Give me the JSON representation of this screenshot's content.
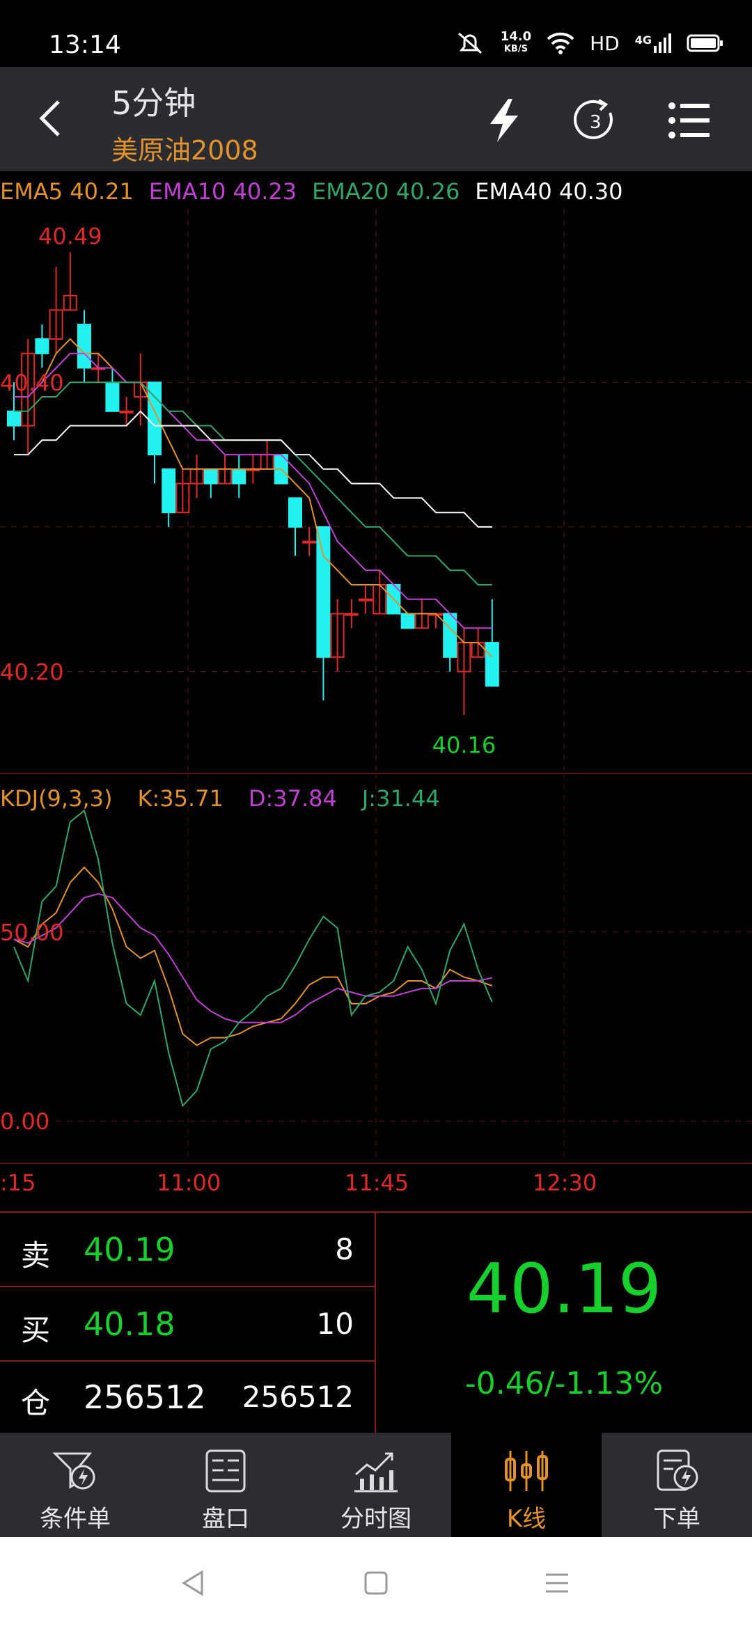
{
  "status": {
    "time": "13:14",
    "net_speed_value": "14.0",
    "net_speed_unit": "KB/S",
    "hd": "HD",
    "signal": "4G"
  },
  "header": {
    "title": "5分钟",
    "subtitle": "美原油2008"
  },
  "ema": {
    "ema5": "EMA5 40.21",
    "ema10": "EMA10 40.23",
    "ema20": "EMA20 40.26",
    "ema40": "EMA40 40.30"
  },
  "kdj": {
    "name": "KDJ(9,3,3)",
    "k": "K:35.71",
    "d": "D:37.84",
    "j": "J:31.44"
  },
  "colors": {
    "ema5": "#e3922c",
    "ema10": "#c241d4",
    "ema20": "#2fa86a",
    "ema40": "#ffffff",
    "up": "#e02a2a",
    "down": "#23f2f0",
    "green": "#17d02d",
    "accent": "#e3922c"
  },
  "chart_data": [
    {
      "type": "candlestick",
      "title": "",
      "price_labels": {
        "high": "40.49",
        "low": "40.16",
        "axis_top": "40.40",
        "axis_bottom": "40.20"
      },
      "ylim": [
        40.13,
        40.52
      ],
      "x_ticks": [
        ":15",
        "11:00",
        "11:45",
        "12:30"
      ],
      "candles": [
        {
          "o": 40.38,
          "c": 40.37,
          "h": 40.4,
          "l": 40.36
        },
        {
          "o": 40.37,
          "c": 40.42,
          "h": 40.43,
          "l": 40.35
        },
        {
          "o": 40.43,
          "c": 40.42,
          "h": 40.44,
          "l": 40.41
        },
        {
          "o": 40.43,
          "c": 40.45,
          "h": 40.48,
          "l": 40.42
        },
        {
          "o": 40.45,
          "c": 40.46,
          "h": 40.49,
          "l": 40.45
        },
        {
          "o": 40.44,
          "c": 40.41,
          "h": 40.45,
          "l": 40.4
        },
        {
          "o": 40.41,
          "c": 40.41,
          "h": 40.42,
          "l": 40.4
        },
        {
          "o": 40.4,
          "c": 40.38,
          "h": 40.41,
          "l": 40.38
        },
        {
          "o": 40.38,
          "c": 40.38,
          "h": 40.39,
          "l": 40.37
        },
        {
          "o": 40.39,
          "c": 40.4,
          "h": 40.42,
          "l": 40.37
        },
        {
          "o": 40.4,
          "c": 40.35,
          "h": 40.4,
          "l": 40.33
        },
        {
          "o": 40.34,
          "c": 40.31,
          "h": 40.34,
          "l": 40.3
        },
        {
          "o": 40.31,
          "c": 40.33,
          "h": 40.34,
          "l": 40.31
        },
        {
          "o": 40.33,
          "c": 40.34,
          "h": 40.35,
          "l": 40.32
        },
        {
          "o": 40.34,
          "c": 40.33,
          "h": 40.34,
          "l": 40.32
        },
        {
          "o": 40.33,
          "c": 40.34,
          "h": 40.35,
          "l": 40.33
        },
        {
          "o": 40.34,
          "c": 40.33,
          "h": 40.35,
          "l": 40.32
        },
        {
          "o": 40.34,
          "c": 40.34,
          "h": 40.35,
          "l": 40.33
        },
        {
          "o": 40.34,
          "c": 40.35,
          "h": 40.36,
          "l": 40.34
        },
        {
          "o": 40.35,
          "c": 40.33,
          "h": 40.35,
          "l": 40.33
        },
        {
          "o": 40.32,
          "c": 40.3,
          "h": 40.32,
          "l": 40.28
        },
        {
          "o": 40.29,
          "c": 40.29,
          "h": 40.3,
          "l": 40.28
        },
        {
          "o": 40.3,
          "c": 40.21,
          "h": 40.3,
          "l": 40.18
        },
        {
          "o": 40.21,
          "c": 40.24,
          "h": 40.25,
          "l": 40.2
        },
        {
          "o": 40.24,
          "c": 40.24,
          "h": 40.25,
          "l": 40.23
        },
        {
          "o": 40.25,
          "c": 40.25,
          "h": 40.26,
          "l": 40.24
        },
        {
          "o": 40.24,
          "c": 40.26,
          "h": 40.27,
          "l": 40.24
        },
        {
          "o": 40.26,
          "c": 40.24,
          "h": 40.26,
          "l": 40.24
        },
        {
          "o": 40.24,
          "c": 40.23,
          "h": 40.24,
          "l": 40.23
        },
        {
          "o": 40.23,
          "c": 40.24,
          "h": 40.25,
          "l": 40.23
        },
        {
          "o": 40.24,
          "c": 40.24,
          "h": 40.24,
          "l": 40.23
        },
        {
          "o": 40.24,
          "c": 40.21,
          "h": 40.24,
          "l": 40.2
        },
        {
          "o": 40.2,
          "c": 40.22,
          "h": 40.23,
          "l": 40.17
        },
        {
          "o": 40.21,
          "c": 40.22,
          "h": 40.23,
          "l": 40.21
        },
        {
          "o": 40.22,
          "c": 40.19,
          "h": 40.25,
          "l": 40.19
        }
      ],
      "series": [
        {
          "name": "EMA5",
          "color": "#e3922c",
          "values": [
            40.39,
            40.39,
            40.4,
            40.42,
            40.43,
            40.42,
            40.42,
            40.41,
            40.4,
            40.4,
            40.38,
            40.36,
            40.34,
            40.34,
            40.34,
            40.34,
            40.34,
            40.34,
            40.34,
            40.34,
            40.33,
            40.32,
            40.28,
            40.27,
            40.26,
            40.26,
            40.26,
            40.25,
            40.24,
            40.24,
            40.24,
            40.23,
            40.22,
            40.22,
            40.21
          ]
        },
        {
          "name": "EMA10",
          "color": "#c241d4",
          "values": [
            40.39,
            40.39,
            40.4,
            40.41,
            40.42,
            40.42,
            40.41,
            40.41,
            40.4,
            40.4,
            40.39,
            40.38,
            40.37,
            40.36,
            40.36,
            40.35,
            40.35,
            40.35,
            40.35,
            40.35,
            40.34,
            40.33,
            40.31,
            40.29,
            40.28,
            40.27,
            40.27,
            40.26,
            40.25,
            40.25,
            40.25,
            40.24,
            40.23,
            40.23,
            40.23
          ]
        },
        {
          "name": "EMA20",
          "color": "#2fa86a",
          "values": [
            40.38,
            40.38,
            40.39,
            40.39,
            40.4,
            40.4,
            40.4,
            40.4,
            40.4,
            40.4,
            40.39,
            40.38,
            40.38,
            40.37,
            40.37,
            40.36,
            40.36,
            40.36,
            40.36,
            40.36,
            40.35,
            40.34,
            40.33,
            40.32,
            40.31,
            40.3,
            40.3,
            40.29,
            40.28,
            40.28,
            40.28,
            40.27,
            40.27,
            40.26,
            40.26
          ]
        },
        {
          "name": "EMA40",
          "color": "#ffffff",
          "values": [
            40.35,
            40.35,
            40.36,
            40.36,
            40.37,
            40.37,
            40.37,
            40.37,
            40.37,
            40.38,
            40.37,
            40.37,
            40.37,
            40.37,
            40.36,
            40.36,
            40.36,
            40.36,
            40.36,
            40.36,
            40.35,
            40.35,
            40.34,
            40.34,
            40.33,
            40.33,
            40.33,
            40.32,
            40.32,
            40.32,
            40.31,
            40.31,
            40.31,
            40.3,
            40.3
          ]
        }
      ]
    },
    {
      "type": "line",
      "title": "",
      "axis_labels": {
        "top": "50.00",
        "bottom": "0.00"
      },
      "ylim": [
        -11,
        92
      ],
      "series": [
        {
          "name": "K",
          "color": "#e3922c",
          "values": [
            48,
            46,
            52,
            55,
            63,
            67,
            63,
            56,
            46,
            43,
            45,
            35,
            23,
            20,
            22,
            22,
            23,
            25,
            26,
            27,
            31,
            36,
            38,
            38,
            31,
            31,
            33,
            34,
            37,
            37,
            35,
            40,
            38,
            37,
            35.71
          ]
        },
        {
          "name": "D",
          "color": "#c241d4",
          "values": [
            48,
            47,
            49,
            51,
            55,
            59,
            60,
            59,
            55,
            51,
            49,
            44,
            38,
            32,
            29,
            27,
            26,
            26,
            26,
            26,
            28,
            31,
            33,
            35,
            34,
            33,
            33,
            33,
            34,
            35,
            35,
            37,
            37,
            37,
            37.84
          ]
        },
        {
          "name": "J",
          "color": "#2fa86a",
          "values": [
            46,
            37,
            58,
            62,
            79,
            82,
            69,
            47,
            31,
            28,
            37,
            18,
            4,
            8,
            19,
            21,
            26,
            29,
            33,
            35,
            41,
            48,
            54,
            51,
            28,
            33,
            34,
            37,
            46,
            40,
            31,
            45,
            52,
            40,
            31.44
          ]
        }
      ]
    }
  ],
  "quote": {
    "sell_label": "卖",
    "sell_price": "40.19",
    "sell_vol": "8",
    "buy_label": "买",
    "buy_price": "40.18",
    "buy_vol": "10",
    "pos_label": "仓",
    "pos_value": "256512",
    "pos_value2": "256512",
    "last_price": "40.19",
    "change": "-0.46/-1.13%"
  },
  "tabs": [
    {
      "label": "条件单",
      "icon": "condition-order-icon"
    },
    {
      "label": "盘口",
      "icon": "order-book-icon"
    },
    {
      "label": "分时图",
      "icon": "intraday-chart-icon"
    },
    {
      "label": "K线",
      "icon": "kline-icon",
      "active": true
    },
    {
      "label": "下单",
      "icon": "place-order-icon"
    }
  ]
}
